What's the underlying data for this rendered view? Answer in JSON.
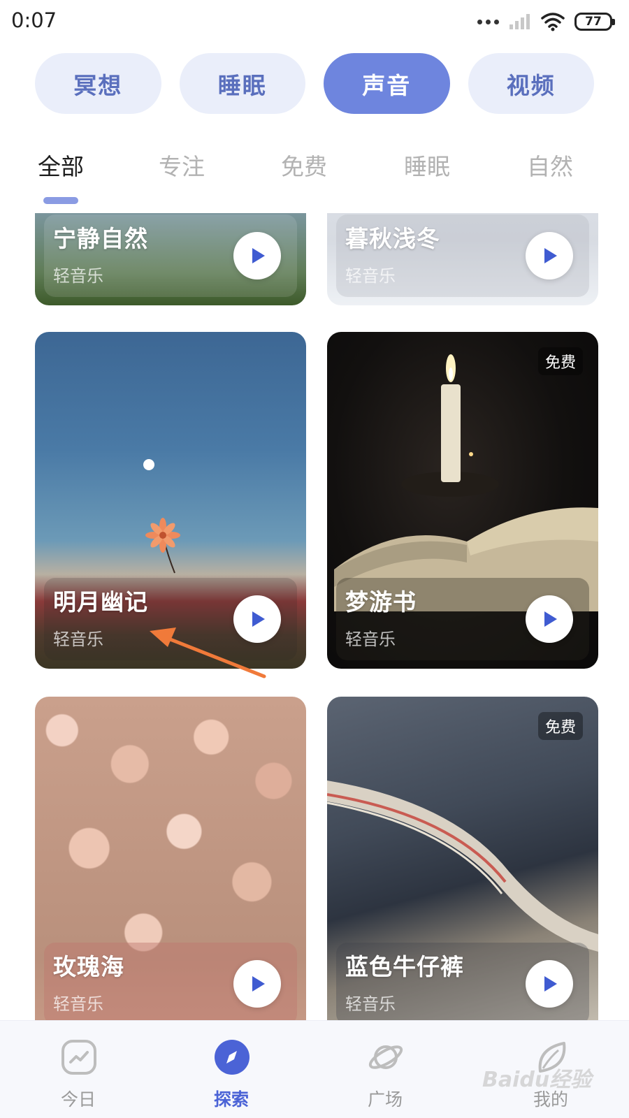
{
  "status_bar": {
    "time": "0:07",
    "battery": "77"
  },
  "segments": [
    {
      "label": "冥想"
    },
    {
      "label": "睡眠"
    },
    {
      "label": "声音",
      "active": true
    },
    {
      "label": "视频"
    }
  ],
  "subtabs": [
    {
      "label": "全部",
      "active": true
    },
    {
      "label": "专注"
    },
    {
      "label": "免费"
    },
    {
      "label": "睡眠"
    },
    {
      "label": "自然"
    }
  ],
  "cards": [
    {
      "title": "宁静自然",
      "subtitle": "轻音乐"
    },
    {
      "title": "暮秋浅冬",
      "subtitle": "轻音乐"
    },
    {
      "title": "明月幽记",
      "subtitle": "轻音乐"
    },
    {
      "title": "梦游书",
      "subtitle": "轻音乐",
      "badge": "免费"
    },
    {
      "title": "玫瑰海",
      "subtitle": "轻音乐"
    },
    {
      "title": "蓝色牛仔裤",
      "subtitle": "轻音乐",
      "badge": "免费"
    }
  ],
  "bottom_nav": [
    {
      "label": "今日",
      "icon": "chart-trend-icon"
    },
    {
      "label": "探索",
      "icon": "compass-icon",
      "active": true
    },
    {
      "label": "广场",
      "icon": "planet-icon"
    },
    {
      "label": "我的",
      "icon": "profile-leaf-icon"
    }
  ],
  "watermark": "Baidu经验",
  "colors": {
    "accent": "#6e85de",
    "segment_bg": "#eaeefa",
    "segment_text": "#5a6fbd",
    "nav_active": "#4b63d6",
    "play_icon": "#3f5bd1",
    "arrow": "#f07a3a"
  }
}
